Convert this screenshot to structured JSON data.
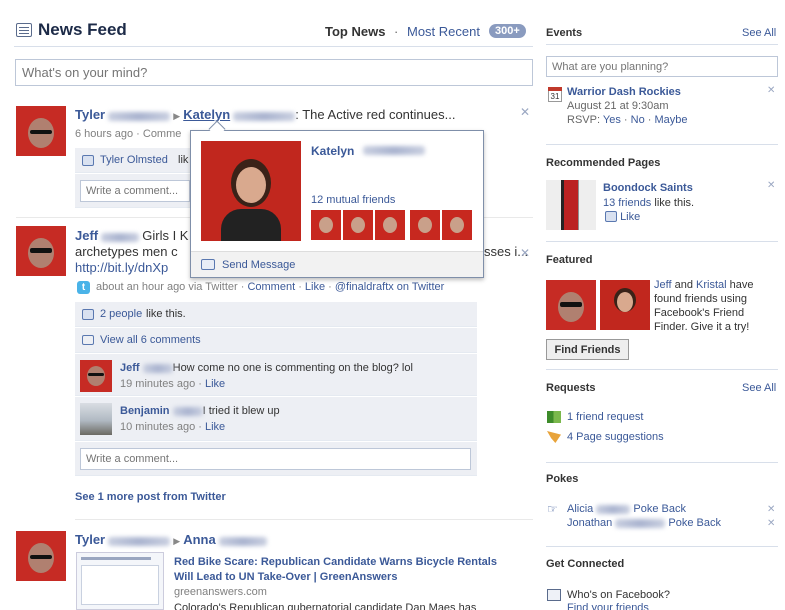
{
  "header": {
    "title": "News Feed",
    "top_news": "Top News",
    "sep": "·",
    "most_recent": "Most Recent",
    "count": "300+"
  },
  "status": {
    "placeholder": "What's on your mind?"
  },
  "post1": {
    "author": "Tyler",
    "target": "Katelyn",
    "text": ": The Active red continues...",
    "time": "6 hours ago · Comme",
    "liker": "Tyler Olmsted",
    "liker_suffix": "lik",
    "comment_placeholder": "Write a comment..."
  },
  "popup": {
    "name": "Katelyn",
    "mutual": "12 mutual friends",
    "send_message": "Send Message"
  },
  "post2": {
    "author": "Jeff",
    "text_line1": "Girls I K",
    "text_line2": "archetypes men c",
    "text_line2_end": "sses i...",
    "link": "http://bit.ly/dnXp",
    "meta_time": "about an hour ago via Twitter ·",
    "comment_link": "Comment",
    "like_link": "Like",
    "handle": "@finaldraftx on Twitter",
    "likes": "2 people",
    "likes_suffix": "like this.",
    "view_all": "View all 6 comments",
    "comments": [
      {
        "author": "Jeff",
        "text": "How come no one is commenting on the blog? lol",
        "time": "19 minutes ago ·",
        "like": "Like"
      },
      {
        "author": "Benjamin",
        "text": "I tried it blew up",
        "time": "10 minutes ago ·",
        "like": "Like"
      }
    ],
    "comment_placeholder": "Write a comment..."
  },
  "see_more": "See 1 more post from Twitter",
  "post3": {
    "author": "Tyler",
    "arrow": "▶",
    "target": "Anna",
    "link_title_1": "Red Bike Scare: Republican Candidate Warns Bicycle Rentals",
    "link_title_2": "Will Lead to UN Take-Over | GreenAnswers",
    "domain": "greenanswers.com",
    "snippet": "Colorado's Republican gubernatorial candidate Dan Maes has"
  },
  "events": {
    "title": "Events",
    "see_all": "See All",
    "placeholder": "What are you planning?",
    "cal_day": "31",
    "event_name": "Warrior Dash Rockies",
    "event_date": "August 21 at 9:30am",
    "rsvp_label": "RSVP:",
    "rsvp_yes": "Yes",
    "rsvp_no": "No",
    "rsvp_maybe": "Maybe",
    "rsvp_sep": "·"
  },
  "recommended": {
    "title": "Recommended Pages",
    "page_name": "Boondock Saints",
    "friends_count": "13 friends",
    "friends_suffix": "like this.",
    "like": "Like"
  },
  "featured": {
    "title": "Featured",
    "name1": "Jeff",
    "and": "and",
    "name2": "Kristal",
    "line1_end": "have",
    "line2": "found friends using",
    "line3": "Facebook's Friend",
    "line4": "Finder. Give it a try!",
    "button": "Find Friends"
  },
  "requests": {
    "title": "Requests",
    "see_all": "See All",
    "friend_request": "1 friend request",
    "page_suggestions": "4 Page suggestions"
  },
  "pokes": {
    "title": "Pokes",
    "items": [
      {
        "name": "Alicia",
        "action": "Poke Back"
      },
      {
        "name": "Jonathan",
        "action": "Poke Back"
      }
    ]
  },
  "connected": {
    "title": "Get Connected",
    "whos_on": "Who's on Facebook?",
    "find_friends": "Find your friends"
  },
  "colors": {
    "link": "#3b5998",
    "badge": "#8a9bbf",
    "profile_red": "#c62b24"
  }
}
